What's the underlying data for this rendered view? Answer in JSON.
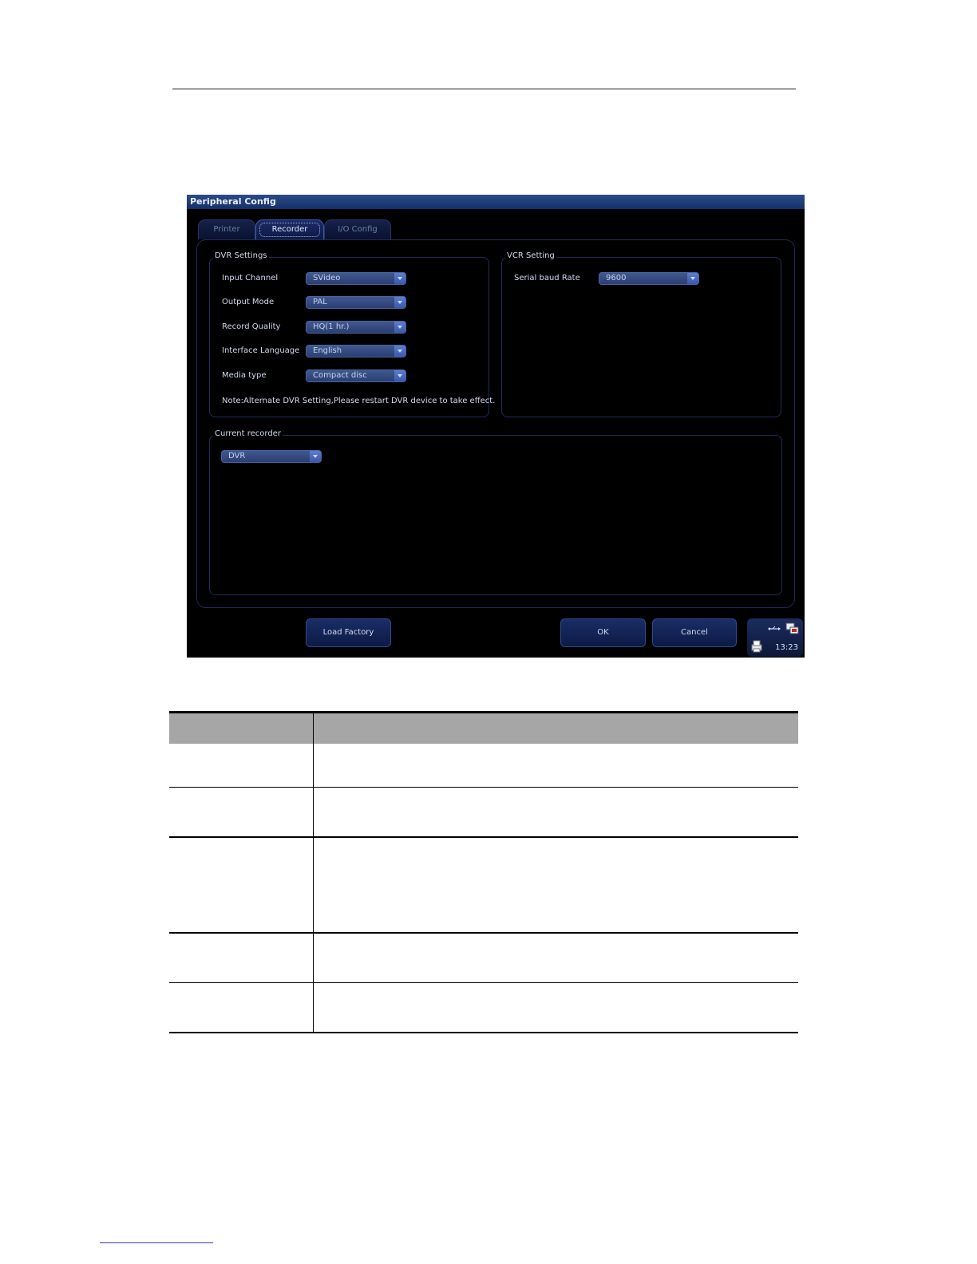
{
  "window": {
    "title": "Peripheral Config"
  },
  "tabs": [
    {
      "label": "Printer",
      "active": false
    },
    {
      "label": "Recorder",
      "active": true
    },
    {
      "label": "I/O Config",
      "active": false
    }
  ],
  "dvr": {
    "title": "DVR Settings",
    "fields": [
      {
        "label": "Input Channel",
        "value": "SVideo"
      },
      {
        "label": "Output Mode",
        "value": "PAL"
      },
      {
        "label": "Record Quality",
        "value": "HQ(1 hr.)"
      },
      {
        "label": "Interface Language",
        "value": "English"
      },
      {
        "label": "Media type",
        "value": "Compact disc"
      }
    ],
    "note": "Note:Alternate DVR Setting,Please restart DVR device to take effect."
  },
  "vcr": {
    "title": "VCR Setting",
    "fields": [
      {
        "label": "Serial baud Rate",
        "value": "9600"
      }
    ]
  },
  "current": {
    "title": "Current recorder",
    "value": "DVR"
  },
  "buttons": {
    "load_factory": "Load Factory",
    "ok": "OK",
    "cancel": "Cancel"
  },
  "tray": {
    "time": "13:23"
  },
  "table": {
    "headers": [
      "",
      ""
    ],
    "rows": [
      [
        "",
        ""
      ],
      [
        "",
        ""
      ],
      [
        "",
        ""
      ],
      [
        "",
        ""
      ],
      [
        "",
        ""
      ]
    ]
  }
}
